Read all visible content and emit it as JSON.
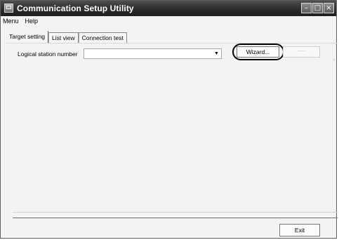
{
  "window": {
    "title": "Communication Setup Utility"
  },
  "menu": {
    "items": [
      "Menu",
      "Help"
    ]
  },
  "tabs": [
    {
      "label": "Target setting"
    },
    {
      "label": "List view"
    },
    {
      "label": "Connection test"
    }
  ],
  "target_setting": {
    "logical_station_label": "Logical station number",
    "logical_station_value": "",
    "wizard_button": "Wizard...",
    "secondary_button": "-----"
  },
  "footer": {
    "exit_button": "Exit"
  },
  "icons": {
    "app": "app-icon",
    "dropdown": "chevron-down-icon",
    "minimize": "minimize-icon",
    "maximize": "maximize-icon",
    "close": "close-icon"
  }
}
